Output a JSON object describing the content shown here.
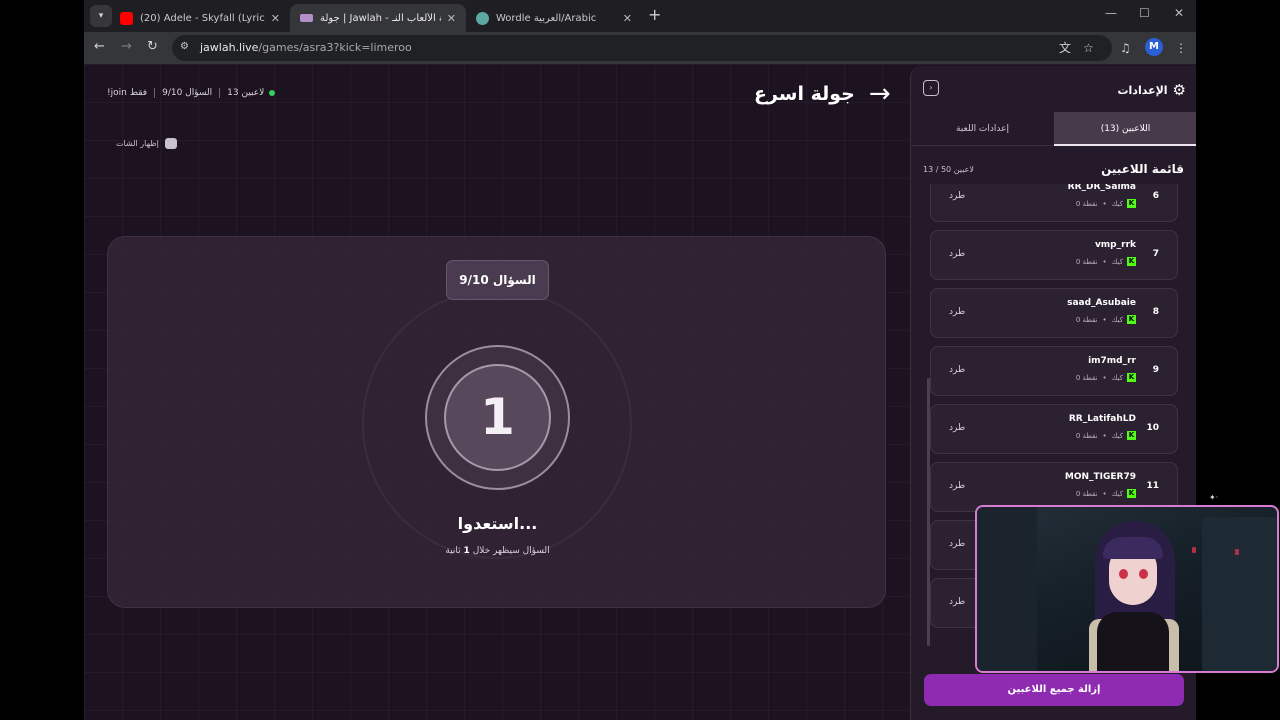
{
  "browser": {
    "tabs": [
      {
        "title": "(20) Adele - Skyfall (Lyrics) - You",
        "favicon": "youtube-icon",
        "active": false
      },
      {
        "title": "جولة | Jawlah - منصة الألعاب النـ",
        "favicon": "jawlah-icon",
        "active": true
      },
      {
        "title": "Wordle العربية/Arabic",
        "favicon": "globe-icon",
        "active": false
      }
    ],
    "url_domain": "jawlah.live",
    "url_path": "/games/asra3?kick=limeroo",
    "profile_initial": "M"
  },
  "header": {
    "players_online": "13 لاعبين",
    "question_progress": "السؤال 9/10",
    "join_hint": "!join فقط",
    "game_title": "جولة اسرع",
    "show_chat": "إظهار الشات"
  },
  "countdown": {
    "question_label": "السؤال 9/10",
    "number": "1",
    "ready_text": "استعدوا...",
    "sub_prefix": "السؤال سيظهر خلال",
    "sub_value": "1",
    "sub_suffix": "ثانية"
  },
  "sidebar": {
    "title": "الإعدادات",
    "tab_players": "اللاعبين (13)",
    "tab_settings": "إعدادات اللعبة",
    "list_title": "قائمة اللاعبين",
    "list_count": "13 / 50 لاعبين",
    "kick_label": "طرد",
    "remove_all": "إزالة جميع اللاعبين",
    "players": [
      {
        "rank": "6",
        "name": "RR_DR_Salma",
        "platform": "كيك",
        "points": "0 نقطة"
      },
      {
        "rank": "7",
        "name": "vmp_rrk",
        "platform": "كيك",
        "points": "0 نقطة"
      },
      {
        "rank": "8",
        "name": "saad_Asubaie",
        "platform": "كيك",
        "points": "0 نقطة"
      },
      {
        "rank": "9",
        "name": "im7md_rr",
        "platform": "كيك",
        "points": "0 نقطة"
      },
      {
        "rank": "10",
        "name": "RR_LatifahLD",
        "platform": "كيك",
        "points": "0 نقطة"
      },
      {
        "rank": "11",
        "name": "MON_TIGER79",
        "platform": "كيك",
        "points": "0 نقطة"
      },
      {
        "rank": "",
        "name": "",
        "platform": "",
        "points": ""
      },
      {
        "rank": "",
        "name": "",
        "platform": "",
        "points": ""
      }
    ]
  },
  "colors": {
    "accent": "#8e2bb0",
    "online": "#34d058",
    "kick_green": "#53fc18",
    "page_bg": "#1d121f"
  }
}
